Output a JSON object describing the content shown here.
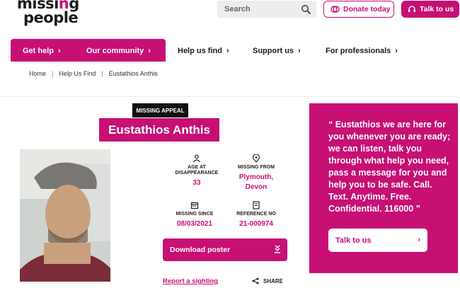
{
  "header": {
    "logo_line1": "missing",
    "logo_line2": "people",
    "search_placeholder": "Search",
    "donate_label": "Donate today",
    "talk_label": "Talk to us"
  },
  "nav": [
    {
      "label": "Get help"
    },
    {
      "label": "Our community"
    },
    {
      "label": "Help us find"
    },
    {
      "label": "Support us"
    },
    {
      "label": "For professionals"
    }
  ],
  "breadcrumb": [
    "Home",
    "Help Us Find",
    "Eustathios Anthis"
  ],
  "appeal": {
    "tag": "MISSING APPEAL",
    "name": "Eustathios Anthis",
    "age_label_1": "AGE AT",
    "age_label_2": "DISAPPEARANCE",
    "age_value": "33",
    "from_label": "MISSING FROM",
    "from_value_1": "Plymouth,",
    "from_value_2": "Devon",
    "since_label": "MISSING SINCE",
    "since_value": "08/03/2021",
    "ref_label": "REFERENCE NO",
    "ref_value": "21-000974",
    "poster_label": "Download poster",
    "sighting_label": "Report a sighting",
    "share_label": "SHARE"
  },
  "panel": {
    "quote": "“ Eustathios we are here for you whenever you are ready; we can listen, talk you through what help you need, pass a message for you and help you to be safe. Call. Text. Anytime. Free. Confidential. 116000 ”",
    "button_label": "Talk to us"
  },
  "colors": {
    "brand": "#c70f74",
    "dark": "#111111"
  }
}
